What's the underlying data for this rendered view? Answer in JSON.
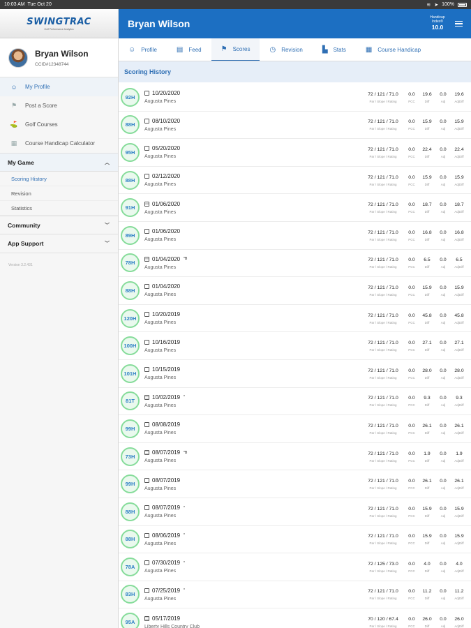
{
  "status_bar": {
    "time": "10:03 AM",
    "date": "Tue Oct 20",
    "battery": "100%"
  },
  "sidebar": {
    "logo": "SWINGTRAC",
    "logo_tagline": "Golf Performance Analytics",
    "user": {
      "name": "Bryan Wilson",
      "id": "CCID#12348744"
    },
    "menu": [
      {
        "label": "My Profile",
        "icon": "profile-icon"
      },
      {
        "label": "Post a Score",
        "icon": "flag-icon"
      },
      {
        "label": "Golf Courses",
        "icon": "golf-course-icon"
      },
      {
        "label": "Course Handicap Calculator",
        "icon": "calculator-icon"
      }
    ],
    "my_game": {
      "label": "My Game",
      "items": [
        "Scoring History",
        "Revision",
        "Statistics"
      ]
    },
    "community": {
      "label": "Community"
    },
    "app_support": {
      "label": "App Support"
    },
    "version": "Version 3.2.431"
  },
  "header": {
    "title": "Bryan Wilson",
    "handicap_label": "Handicap Index®",
    "handicap_value": "10.0"
  },
  "tabs": [
    {
      "label": "Profile",
      "icon": "profile-icon"
    },
    {
      "label": "Feed",
      "icon": "feed-icon"
    },
    {
      "label": "Scores",
      "icon": "flag-icon"
    },
    {
      "label": "Revision",
      "icon": "history-icon"
    },
    {
      "label": "Stats",
      "icon": "stats-icon"
    },
    {
      "label": "Course Handicap",
      "icon": "calculator-icon"
    }
  ],
  "section_title": "Scoring History",
  "column_labels": {
    "psr": "Par / Slope / Rating",
    "pcc": "PCC",
    "diff": "Diff",
    "adj": "Adj",
    "adjdiff": "AdjDiff"
  },
  "scores": [
    {
      "badge": "92H",
      "date": "10/20/2020",
      "mark": "",
      "course": "Augusta Pines",
      "psr": "72 / 121 / 71.0",
      "pcc": "0.0",
      "diff": "19.6",
      "adj": "0.0",
      "adjdiff": "19.6",
      "grid": false
    },
    {
      "badge": "88H",
      "date": "08/10/2020",
      "mark": "",
      "course": "Augusta Pines",
      "psr": "72 / 121 / 71.0",
      "pcc": "0.0",
      "diff": "15.9",
      "adj": "0.0",
      "adjdiff": "15.9",
      "grid": false
    },
    {
      "badge": "95H",
      "date": "05/20/2020",
      "mark": "",
      "course": "Augusta Pines",
      "psr": "72 / 121 / 71.0",
      "pcc": "0.0",
      "diff": "22.4",
      "adj": "0.0",
      "adjdiff": "22.4",
      "grid": false
    },
    {
      "badge": "88H",
      "date": "02/12/2020",
      "mark": "",
      "course": "Augusta Pines",
      "psr": "72 / 121 / 71.0",
      "pcc": "0.0",
      "diff": "15.9",
      "adj": "0.0",
      "adjdiff": "15.9",
      "grid": false
    },
    {
      "badge": "91H",
      "date": "01/06/2020",
      "mark": "",
      "course": "Augusta Pines",
      "psr": "72 / 121 / 71.0",
      "pcc": "0.0",
      "diff": "18.7",
      "adj": "0.0",
      "adjdiff": "18.7",
      "grid": true
    },
    {
      "badge": "89H",
      "date": "01/06/2020",
      "mark": "",
      "course": "Augusta Pines",
      "psr": "72 / 121 / 71.0",
      "pcc": "0.0",
      "diff": "16.8",
      "adj": "0.0",
      "adjdiff": "16.8",
      "grid": false
    },
    {
      "badge": "78H",
      "date": "01/04/2020",
      "mark": "*B",
      "course": "Augusta Pines",
      "psr": "72 / 121 / 71.0",
      "pcc": "0.0",
      "diff": "6.5",
      "adj": "0.0",
      "adjdiff": "6.5",
      "grid": true
    },
    {
      "badge": "88H",
      "date": "01/04/2020",
      "mark": "",
      "course": "Augusta Pines",
      "psr": "72 / 121 / 71.0",
      "pcc": "0.0",
      "diff": "15.9",
      "adj": "0.0",
      "adjdiff": "15.9",
      "grid": false
    },
    {
      "badge": "120H",
      "date": "10/20/2019",
      "mark": "",
      "course": "Augusta Pines",
      "psr": "72 / 121 / 71.0",
      "pcc": "0.0",
      "diff": "45.8",
      "adj": "0.0",
      "adjdiff": "45.8",
      "grid": false
    },
    {
      "badge": "100H",
      "date": "10/16/2019",
      "mark": "",
      "course": "Augusta Pines",
      "psr": "72 / 121 / 71.0",
      "pcc": "0.0",
      "diff": "27.1",
      "adj": "0.0",
      "adjdiff": "27.1",
      "grid": false
    },
    {
      "badge": "101H",
      "date": "10/15/2019",
      "mark": "",
      "course": "Augusta Pines",
      "psr": "72 / 121 / 71.0",
      "pcc": "0.0",
      "diff": "28.0",
      "adj": "0.0",
      "adjdiff": "28.0",
      "grid": false
    },
    {
      "badge": "81T",
      "date": "10/02/2019",
      "mark": "*",
      "course": "Augusta Pines",
      "psr": "72 / 121 / 71.0",
      "pcc": "0.0",
      "diff": "9.3",
      "adj": "0.0",
      "adjdiff": "9.3",
      "grid": true
    },
    {
      "badge": "99H",
      "date": "08/08/2019",
      "mark": "",
      "course": "Augusta Pines",
      "psr": "72 / 121 / 71.0",
      "pcc": "0.0",
      "diff": "26.1",
      "adj": "0.0",
      "adjdiff": "26.1",
      "grid": false
    },
    {
      "badge": "73H",
      "date": "08/07/2019",
      "mark": "*B",
      "course": "Augusta Pines",
      "psr": "72 / 121 / 71.0",
      "pcc": "0.0",
      "diff": "1.9",
      "adj": "0.0",
      "adjdiff": "1.9",
      "grid": true
    },
    {
      "badge": "99H",
      "date": "08/07/2019",
      "mark": "",
      "course": "Augusta Pines",
      "psr": "72 / 121 / 71.0",
      "pcc": "0.0",
      "diff": "26.1",
      "adj": "0.0",
      "adjdiff": "26.1",
      "grid": false
    },
    {
      "badge": "88H",
      "date": "08/07/2019",
      "mark": "*",
      "course": "Augusta Pines",
      "psr": "72 / 121 / 71.0",
      "pcc": "0.0",
      "diff": "15.9",
      "adj": "0.0",
      "adjdiff": "15.9",
      "grid": false
    },
    {
      "badge": "88H",
      "date": "08/06/2019",
      "mark": "*",
      "course": "Augusta Pines",
      "psr": "72 / 121 / 71.0",
      "pcc": "0.0",
      "diff": "15.9",
      "adj": "0.0",
      "adjdiff": "15.9",
      "grid": false
    },
    {
      "badge": "78A",
      "date": "07/30/2019",
      "mark": "*",
      "course": "Augusta Pines",
      "psr": "72 / 125 / 73.0",
      "pcc": "0.0",
      "diff": "4.0",
      "adj": "0.0",
      "adjdiff": "4.0",
      "grid": false
    },
    {
      "badge": "83H",
      "date": "07/25/2019",
      "mark": "*",
      "course": "Augusta Pines",
      "psr": "72 / 121 / 71.0",
      "pcc": "0.0",
      "diff": "11.2",
      "adj": "0.0",
      "adjdiff": "11.2",
      "grid": false
    },
    {
      "badge": "95A",
      "date": "05/17/2019",
      "mark": "",
      "course": "Liberty Hills Country Club",
      "psr": "70 / 120 / 67.4",
      "pcc": "0.0",
      "diff": "26.0",
      "adj": "0.0",
      "adjdiff": "26.0",
      "grid": true
    }
  ]
}
